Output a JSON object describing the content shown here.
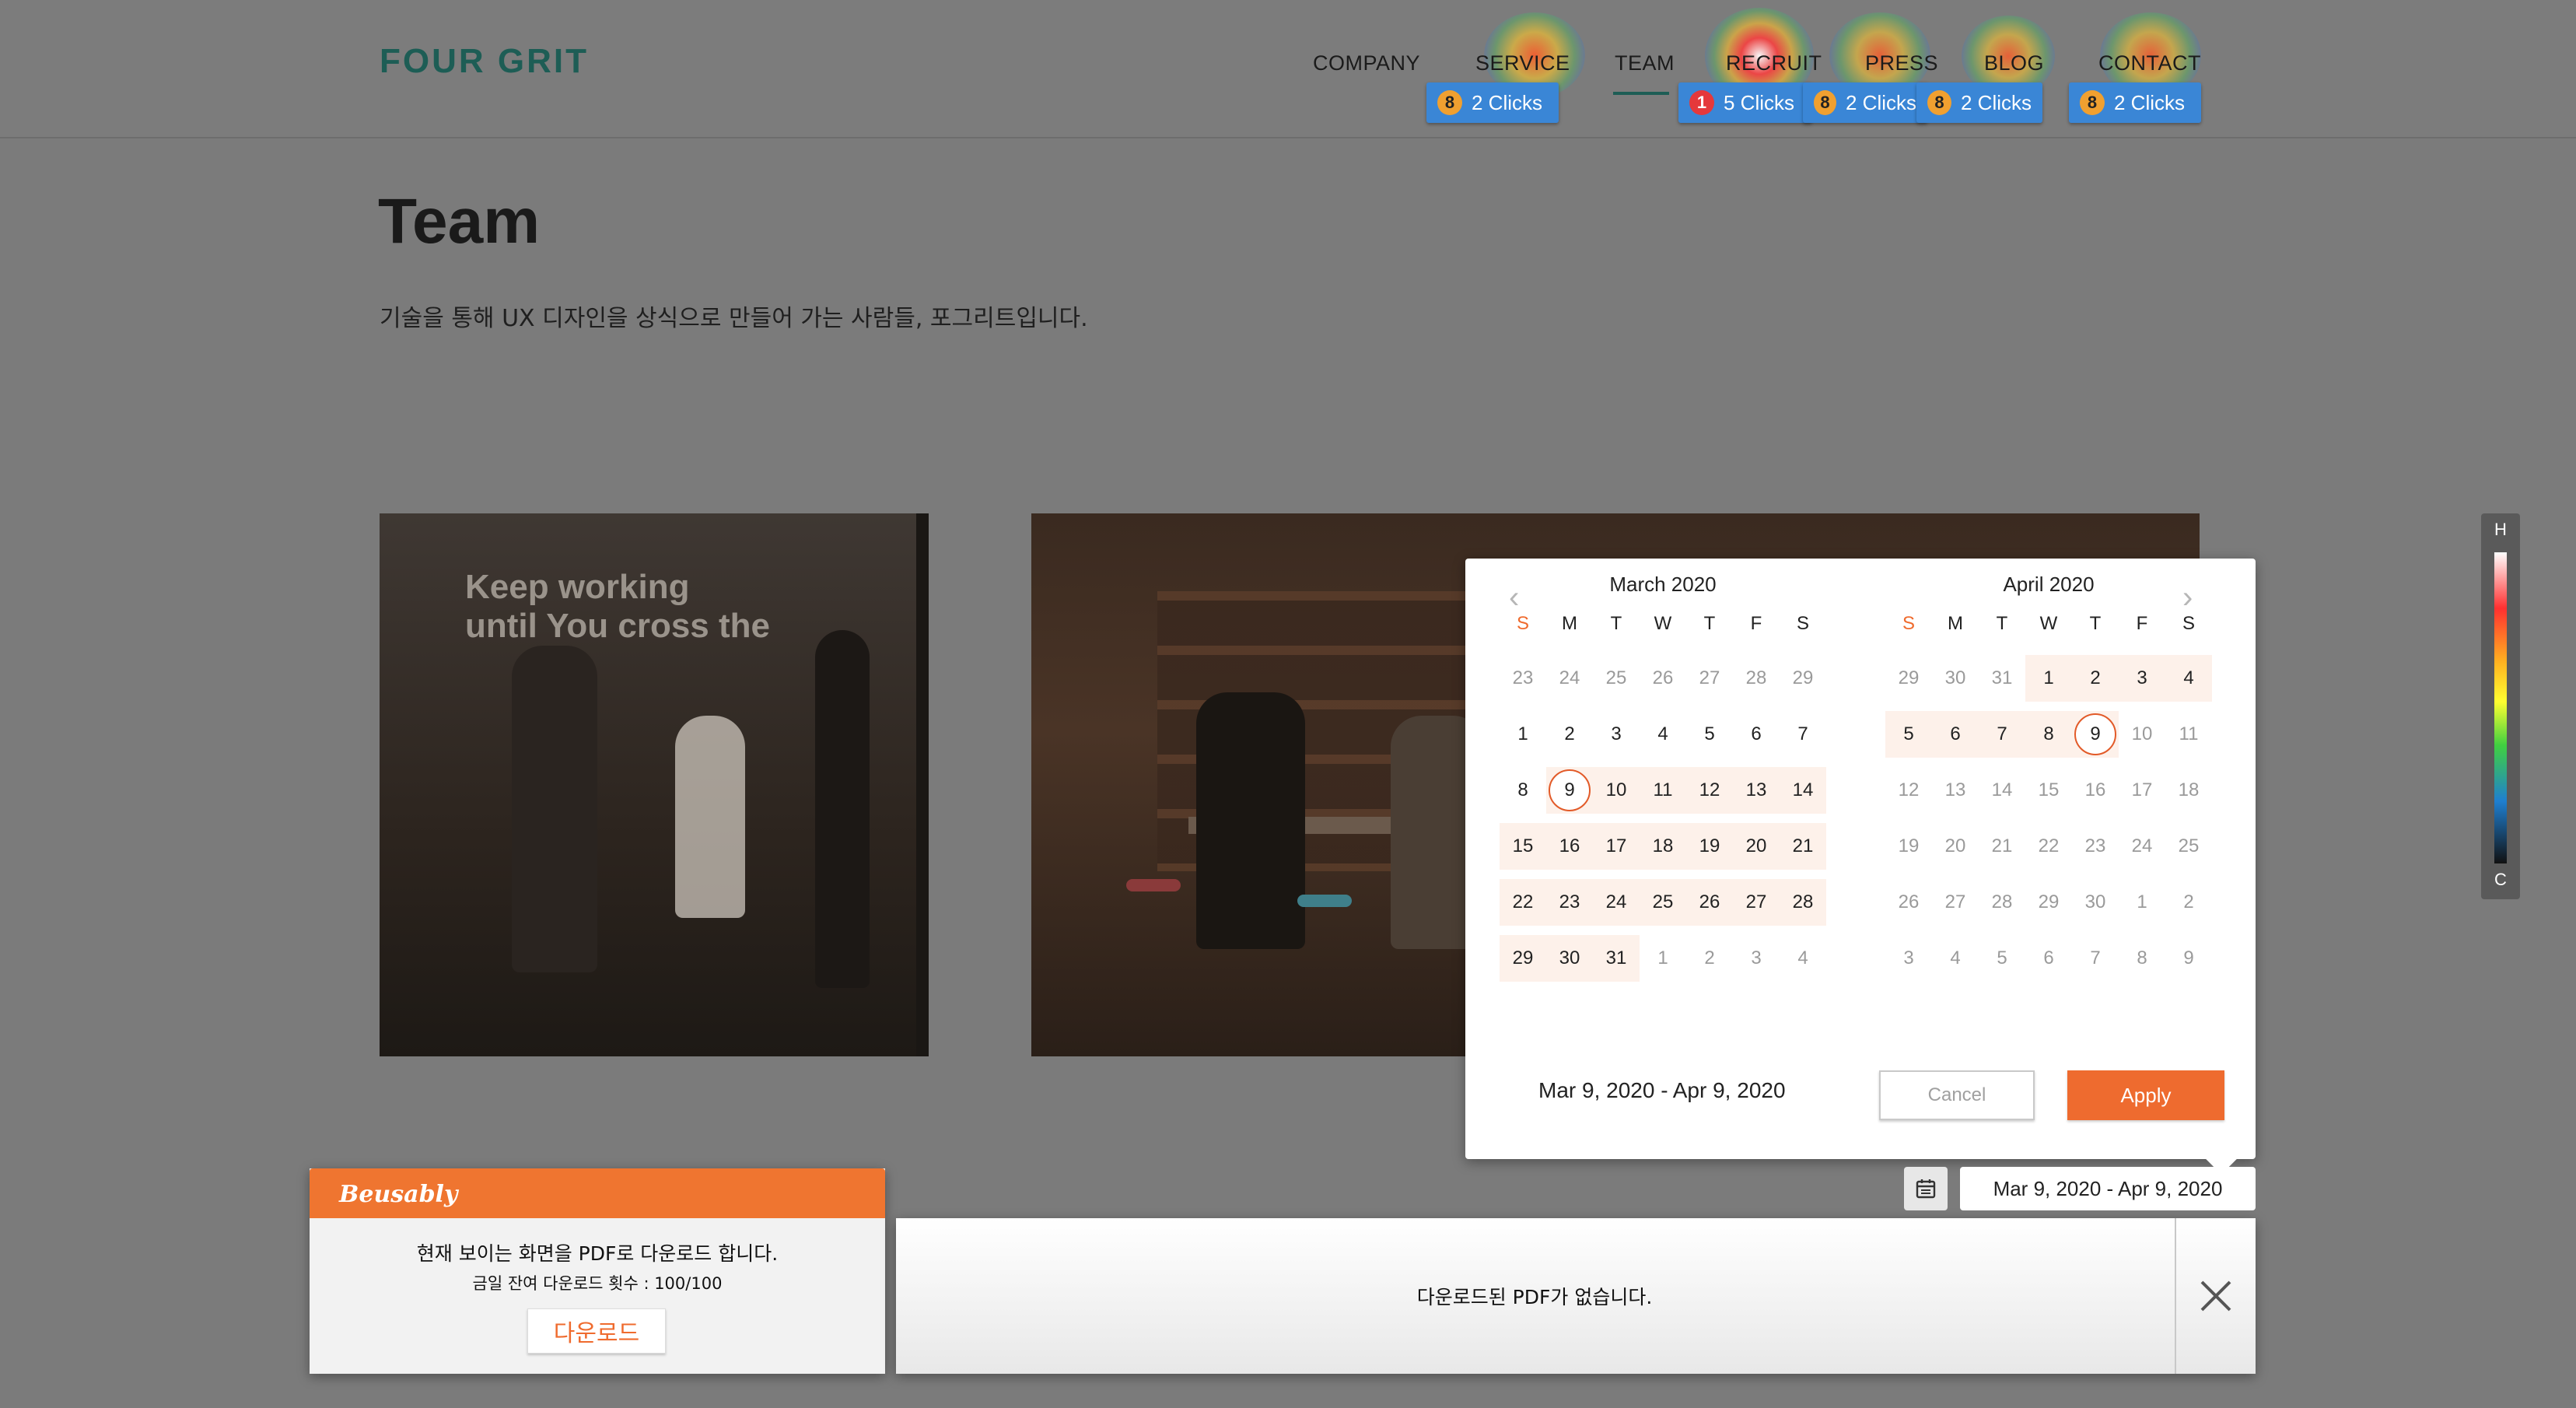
{
  "site": {
    "logo": "FOUR GRIT",
    "nav": [
      "COMPANY",
      "SERVICE",
      "TEAM",
      "RECRUIT",
      "PRESS",
      "BLOG",
      "CONTACT"
    ],
    "active_nav": "TEAM"
  },
  "click_badges": [
    {
      "rank": "8",
      "label": "2 Clicks"
    },
    {
      "rank": "1",
      "label": "5 Clicks"
    },
    {
      "rank": "8",
      "label": "2 Clicks"
    },
    {
      "rank": "8",
      "label": "2 Clicks"
    },
    {
      "rank": "8",
      "label": "2 Clicks"
    }
  ],
  "page": {
    "title": "Team",
    "subtitle": "기술을 통해 UX 디자인을 상식으로 만들어 가는 사람들, 포그리트입니다.",
    "photo_wall_text_1": "Keep working",
    "photo_wall_text_2": "until You cross the"
  },
  "legend": {
    "top": "H",
    "bottom": "C"
  },
  "date_picker": {
    "dow": [
      "S",
      "M",
      "T",
      "W",
      "T",
      "F",
      "S"
    ],
    "left_month": {
      "title": "March 2020",
      "weeks": [
        [
          {
            "d": "23",
            "m": 1
          },
          {
            "d": "24",
            "m": 1
          },
          {
            "d": "25",
            "m": 1
          },
          {
            "d": "26",
            "m": 1
          },
          {
            "d": "27",
            "m": 1
          },
          {
            "d": "28",
            "m": 1
          },
          {
            "d": "29",
            "m": 1
          }
        ],
        [
          {
            "d": "1"
          },
          {
            "d": "2"
          },
          {
            "d": "3"
          },
          {
            "d": "4"
          },
          {
            "d": "5"
          },
          {
            "d": "6"
          },
          {
            "d": "7"
          }
        ],
        [
          {
            "d": "8"
          },
          {
            "d": "9",
            "s": 1
          },
          {
            "d": "10",
            "r": 1
          },
          {
            "d": "11",
            "r": 1
          },
          {
            "d": "12",
            "r": 1
          },
          {
            "d": "13",
            "r": 1
          },
          {
            "d": "14",
            "r": 1
          }
        ],
        [
          {
            "d": "15",
            "r": 1
          },
          {
            "d": "16",
            "r": 1
          },
          {
            "d": "17",
            "r": 1
          },
          {
            "d": "18",
            "r": 1
          },
          {
            "d": "19",
            "r": 1
          },
          {
            "d": "20",
            "r": 1
          },
          {
            "d": "21",
            "r": 1
          }
        ],
        [
          {
            "d": "22",
            "r": 1
          },
          {
            "d": "23",
            "r": 1
          },
          {
            "d": "24",
            "r": 1
          },
          {
            "d": "25",
            "r": 1
          },
          {
            "d": "26",
            "r": 1
          },
          {
            "d": "27",
            "r": 1
          },
          {
            "d": "28",
            "r": 1
          }
        ],
        [
          {
            "d": "29",
            "r": 1
          },
          {
            "d": "30",
            "r": 1
          },
          {
            "d": "31",
            "r": 1
          },
          {
            "d": "1",
            "m": 1
          },
          {
            "d": "2",
            "m": 1
          },
          {
            "d": "3",
            "m": 1
          },
          {
            "d": "4",
            "m": 1
          }
        ]
      ]
    },
    "right_month": {
      "title": "April 2020",
      "weeks": [
        [
          {
            "d": "29",
            "m": 1
          },
          {
            "d": "30",
            "m": 1
          },
          {
            "d": "31",
            "m": 1
          },
          {
            "d": "1",
            "r": 1
          },
          {
            "d": "2",
            "r": 1
          },
          {
            "d": "3",
            "r": 1
          },
          {
            "d": "4",
            "r": 1
          }
        ],
        [
          {
            "d": "5",
            "r": 1
          },
          {
            "d": "6",
            "r": 1
          },
          {
            "d": "7",
            "r": 1
          },
          {
            "d": "8",
            "r": 1
          },
          {
            "d": "9",
            "s": 1
          },
          {
            "d": "10",
            "m": 1
          },
          {
            "d": "11",
            "m": 1
          }
        ],
        [
          {
            "d": "12",
            "m": 1
          },
          {
            "d": "13",
            "m": 1
          },
          {
            "d": "14",
            "m": 1
          },
          {
            "d": "15",
            "m": 1
          },
          {
            "d": "16",
            "m": 1
          },
          {
            "d": "17",
            "m": 1
          },
          {
            "d": "18",
            "m": 1
          }
        ],
        [
          {
            "d": "19",
            "m": 1
          },
          {
            "d": "20",
            "m": 1
          },
          {
            "d": "21",
            "m": 1
          },
          {
            "d": "22",
            "m": 1
          },
          {
            "d": "23",
            "m": 1
          },
          {
            "d": "24",
            "m": 1
          },
          {
            "d": "25",
            "m": 1
          }
        ],
        [
          {
            "d": "26",
            "m": 1
          },
          {
            "d": "27",
            "m": 1
          },
          {
            "d": "28",
            "m": 1
          },
          {
            "d": "29",
            "m": 1
          },
          {
            "d": "30",
            "m": 1
          },
          {
            "d": "1",
            "m": 1
          },
          {
            "d": "2",
            "m": 1
          }
        ],
        [
          {
            "d": "3",
            "m": 1
          },
          {
            "d": "4",
            "m": 1
          },
          {
            "d": "5",
            "m": 1
          },
          {
            "d": "6",
            "m": 1
          },
          {
            "d": "7",
            "m": 1
          },
          {
            "d": "8",
            "m": 1
          },
          {
            "d": "9",
            "m": 1
          }
        ]
      ]
    },
    "range_text": "Mar 9, 2020 - Apr 9, 2020",
    "cancel_label": "Cancel",
    "apply_label": "Apply"
  },
  "date_field": {
    "value": "Mar 9, 2020 - Apr 9, 2020"
  },
  "pdf_panel": {
    "brand": "Beusably",
    "line1": "현재 보이는 화면을 PDF로 다운로드 합니다.",
    "line2": "금일 잔여 다운로드 횟수 : 100/100",
    "download_label": "다운로드",
    "empty_message": "다운로드된 PDF가 없습니다."
  },
  "colors": {
    "accent": "#ee6b2f",
    "brand_teal": "#1d5d55",
    "badge_blue": "#3a86d6"
  }
}
